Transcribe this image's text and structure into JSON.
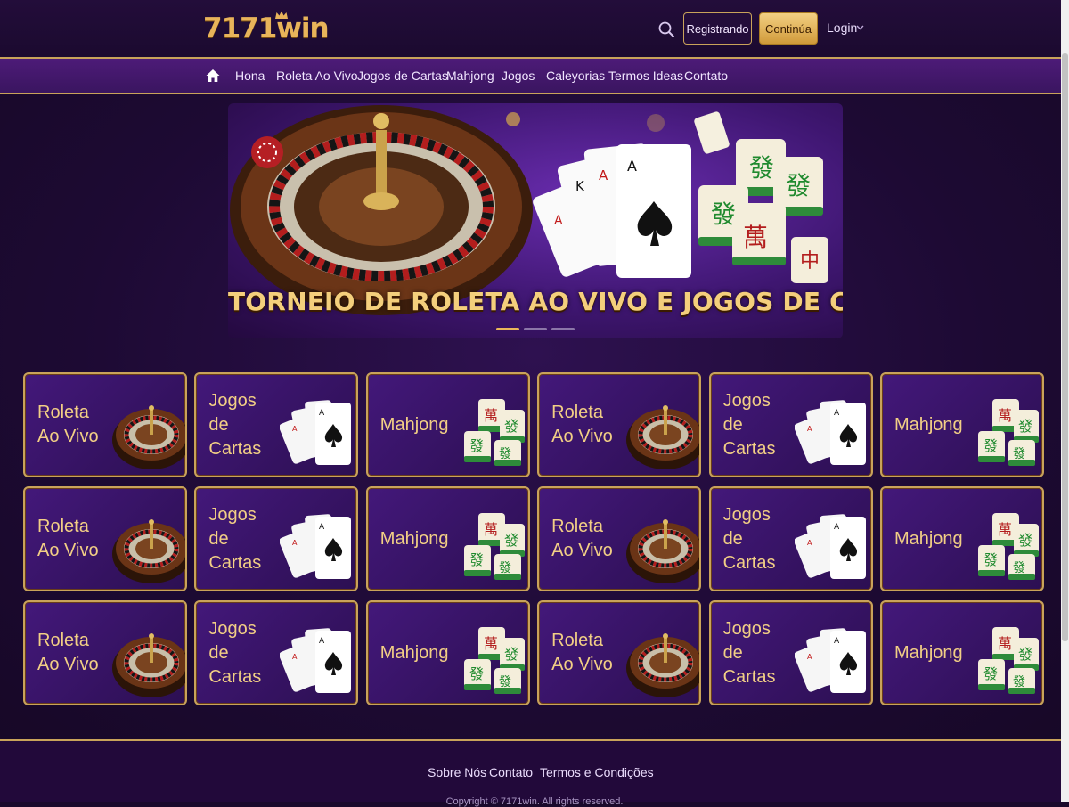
{
  "header": {
    "logo": "7171win",
    "register_label": "Registrando",
    "continue_label": "Continúa",
    "login_label": "Login"
  },
  "nav": {
    "items": [
      "Hona",
      "Roleta Ao Vivo",
      "Jogos de Cartas",
      "Mahjong",
      "Jogos",
      "Caleyorias",
      "Termos Ideas",
      "Contato"
    ]
  },
  "banner": {
    "title": "TORNEIO DE ROLETA AO VIVO E JOGOS DE CARTAS!",
    "slides": 3,
    "active_slide": 1
  },
  "tiles": [
    {
      "label_line1": "Roleta",
      "label_line2": "Ao Vivo",
      "icon": "roulette-icon"
    },
    {
      "label_line1": "Jogos de",
      "label_line2": "Cartas",
      "icon": "cards-icon"
    },
    {
      "label_line1": "Mahjong",
      "label_line2": "",
      "icon": "mahjong-icon"
    },
    {
      "label_line1": "Roleta",
      "label_line2": "Ao Vivo",
      "icon": "roulette-icon"
    },
    {
      "label_line1": "Jogos de",
      "label_line2": "Cartas",
      "icon": "cards-icon"
    },
    {
      "label_line1": "Mahjong",
      "label_line2": "",
      "icon": "mahjong-icon"
    },
    {
      "label_line1": "Roleta",
      "label_line2": "Ao Vivo",
      "icon": "roulette-icon"
    },
    {
      "label_line1": "Jogos de",
      "label_line2": "Cartas",
      "icon": "cards-icon"
    },
    {
      "label_line1": "Mahjong",
      "label_line2": "",
      "icon": "mahjong-icon"
    },
    {
      "label_line1": "Roleta",
      "label_line2": "Ao Vivo",
      "icon": "roulette-icon"
    },
    {
      "label_line1": "Jogos de",
      "label_line2": "Cartas",
      "icon": "cards-icon"
    },
    {
      "label_line1": "Mahjong",
      "label_line2": "",
      "icon": "mahjong-icon"
    },
    {
      "label_line1": "Roleta",
      "label_line2": "Ao Vivo",
      "icon": "roulette-icon"
    },
    {
      "label_line1": "Jogos de",
      "label_line2": "Cartas",
      "icon": "cards-icon"
    },
    {
      "label_line1": "Mahjong",
      "label_line2": "",
      "icon": "mahjong-icon"
    },
    {
      "label_line1": "Roleta",
      "label_line2": "Ao Vivo",
      "icon": "roulette-icon"
    },
    {
      "label_line1": "Jogos de",
      "label_line2": "Cartas",
      "icon": "cards-icon"
    },
    {
      "label_line1": "Mahjong",
      "label_line2": "",
      "icon": "mahjong-icon"
    }
  ],
  "footer": {
    "about_label": "Sobre Nós",
    "contact_label": "Contato",
    "terms_label": "Termos e Condições",
    "copyright": "Copyright © 7171win. All rights reserved."
  },
  "colors": {
    "gold": "#c9a35a",
    "gold_text": "#f2cf85",
    "purple_dark": "#1a0a2c",
    "purple_mid": "#4d1b78"
  }
}
